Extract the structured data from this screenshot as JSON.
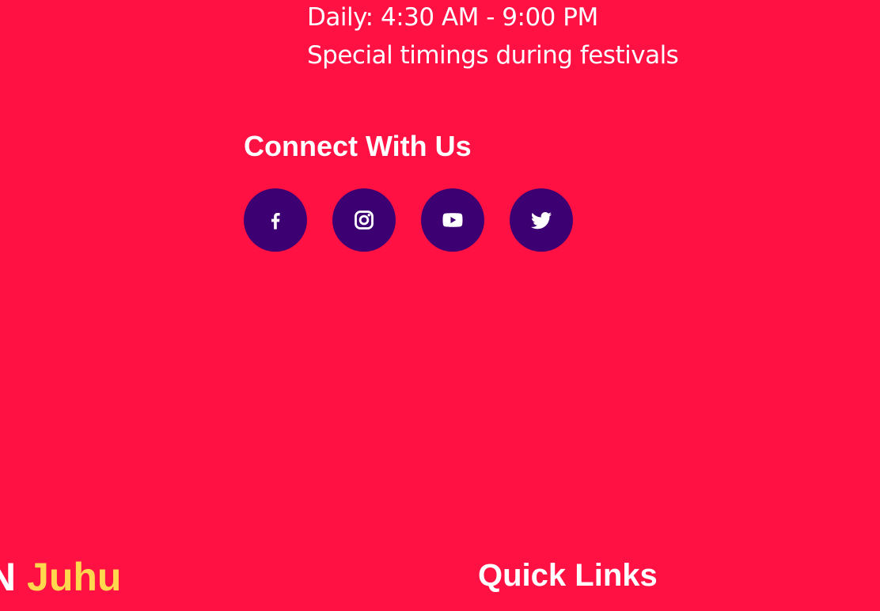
{
  "timings": {
    "daily": "Daily: 4:30 AM - 9:00 PM",
    "special": "Special timings during festivals"
  },
  "connect": {
    "title": "Connect With Us",
    "socials": [
      {
        "name": "facebook",
        "icon": "facebook-icon"
      },
      {
        "name": "instagram",
        "icon": "instagram-icon"
      },
      {
        "name": "youtube",
        "icon": "youtube-icon"
      },
      {
        "name": "twitter",
        "icon": "twitter-icon"
      }
    ]
  },
  "brand": {
    "prefix": "N",
    "accent": "Juhu"
  },
  "quick_links": {
    "title": "Quick Links"
  },
  "colors": {
    "background": "#FF1144",
    "social_button": "#3D0072",
    "accent": "#FFD84D",
    "text": "#FFFFFF"
  }
}
